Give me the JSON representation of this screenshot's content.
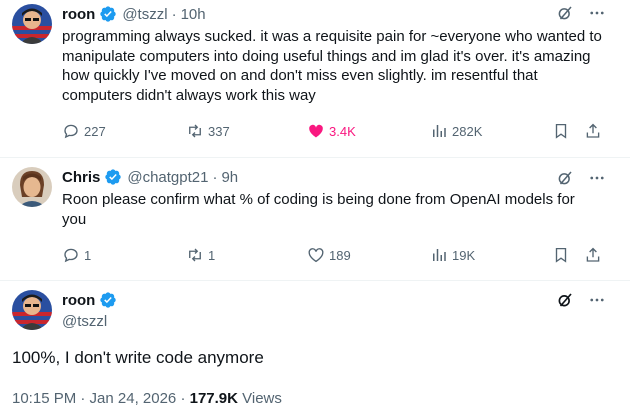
{
  "tweets": [
    {
      "name": "roon",
      "handle": "@tszzl",
      "time": "10h",
      "text": "programming always sucked. it was a requisite pain for ~everyone who wanted to manipulate computers into doing useful things and im glad it's over. it's amazing how quickly I've moved on and don't miss even slightly. im resentful that computers didn't always work this way",
      "replies": "227",
      "reposts": "337",
      "likes": "3.4K",
      "views": "282K"
    },
    {
      "name": "Chris",
      "handle": "@chatgpt21",
      "time": "9h",
      "text": "Roon please confirm what % of coding is being done from OpenAI models for you",
      "replies": "1",
      "reposts": "1",
      "likes": "189",
      "views": "19K"
    }
  ],
  "focused": {
    "name": "roon",
    "handle": "@tszzl",
    "text": "100%, I don't write code anymore",
    "timestamp": "10:15 PM · Jan 24, 2026 · ",
    "views_count": "177.9K",
    "views_label": " Views"
  },
  "separator": "·",
  "colors": {
    "verified": "#1d9bf0",
    "like_active": "#f91880",
    "secondary": "#536471"
  }
}
